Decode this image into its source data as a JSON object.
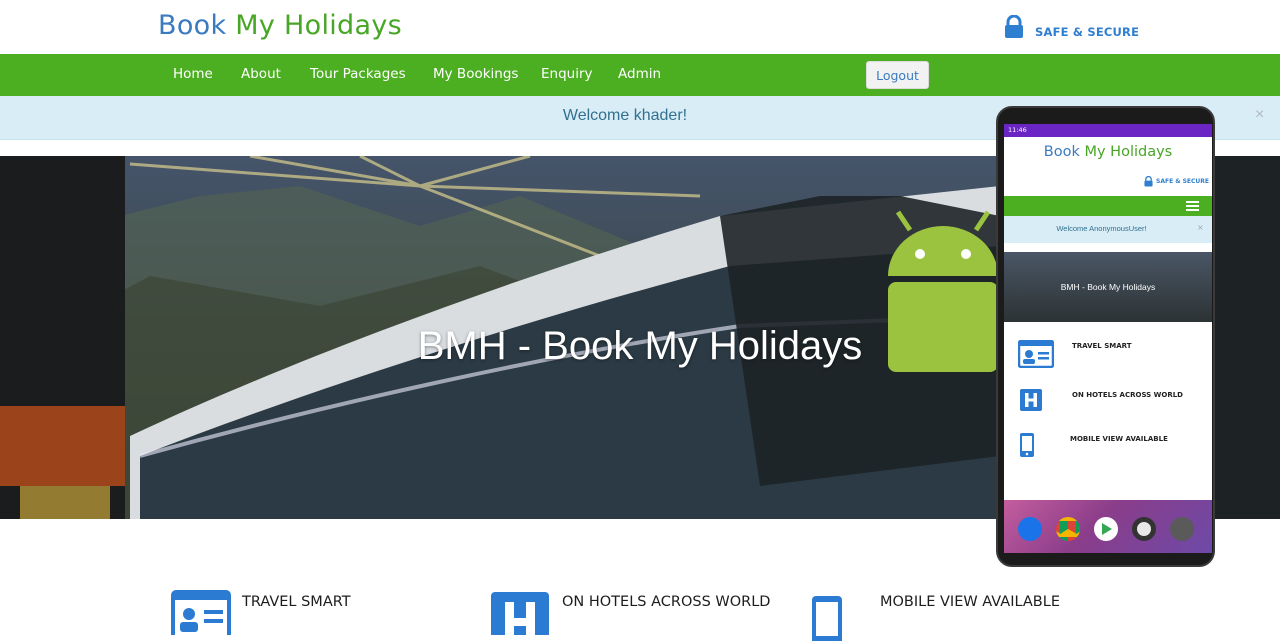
{
  "header": {
    "logo_part1": "Book ",
    "logo_part2": "My Holidays",
    "secure_label": "SAFE & SECURE"
  },
  "nav": {
    "items": [
      "Home",
      "About",
      "Tour Packages",
      "My Bookings",
      "Enquiry",
      "Admin"
    ],
    "logout_label": "Logout"
  },
  "alert": {
    "message": "Welcome khader!",
    "close": "×"
  },
  "hero": {
    "title": "BMH - Book My Holidays"
  },
  "phone": {
    "status_time": "11:46",
    "logo_part1": "Book ",
    "logo_part2": "My Holidays",
    "secure_label": "SAFE & SECURE",
    "alert_message": "Welcome AnonymousUser!",
    "alert_close": "×",
    "hero_title": "BMH - Book My Holidays",
    "features": [
      "TRAVEL SMART",
      "ON HOTELS ACROSS WORLD",
      "MOBILE VIEW AVAILABLE"
    ]
  },
  "features": [
    {
      "label": "TRAVEL SMART",
      "icon": "id-card-icon"
    },
    {
      "label": "ON HOTELS ACROSS WORLD",
      "icon": "hotel-icon"
    },
    {
      "label": "MOBILE VIEW AVAILABLE",
      "icon": "mobile-icon"
    }
  ],
  "colors": {
    "brand_blue": "#3a7bbf",
    "brand_green": "#48a626",
    "nav_green": "#4caf22",
    "alert_bg": "#d9edf7",
    "alert_text": "#31708f"
  }
}
